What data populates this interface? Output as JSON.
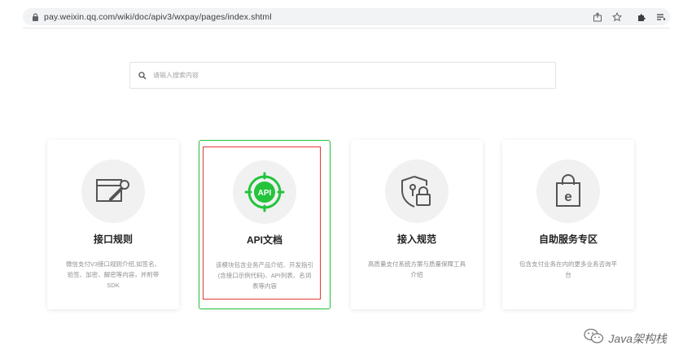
{
  "browser": {
    "url": "pay.weixin.qq.com/wiki/doc/apiv3/wxpay/pages/index.shtml",
    "icons": [
      "lock-icon",
      "share-icon",
      "star-icon",
      "extension-icon",
      "reading-list-icon"
    ]
  },
  "search": {
    "placeholder": "请输入搜索内容"
  },
  "cards": [
    {
      "title": "接口规则",
      "desc": "微信支付V3接口规则介绍,如签名、验签、加密、解密等内容，并附带SDK",
      "icon": "wrench-window-icon"
    },
    {
      "title": "API文档",
      "desc": "该模块包含业务产品介绍、开发指引(含接口示例代码)、API列表、名词表等内容",
      "icon": "api-gear-icon",
      "active": true
    },
    {
      "title": "接入规范",
      "desc": "高质量支付系统方案与质量保障工具介绍",
      "icon": "shield-lock-icon"
    },
    {
      "title": "自助服务专区",
      "desc": "包含支付业务在内的更多业务咨询平台",
      "icon": "shopping-bag-icon"
    }
  ],
  "colors": {
    "active_border": "#23c43c",
    "api_icon": "#23c43c",
    "highlight": "#e53935"
  },
  "watermark": {
    "text": "Java架构栈",
    "icon": "wechat-icon"
  }
}
